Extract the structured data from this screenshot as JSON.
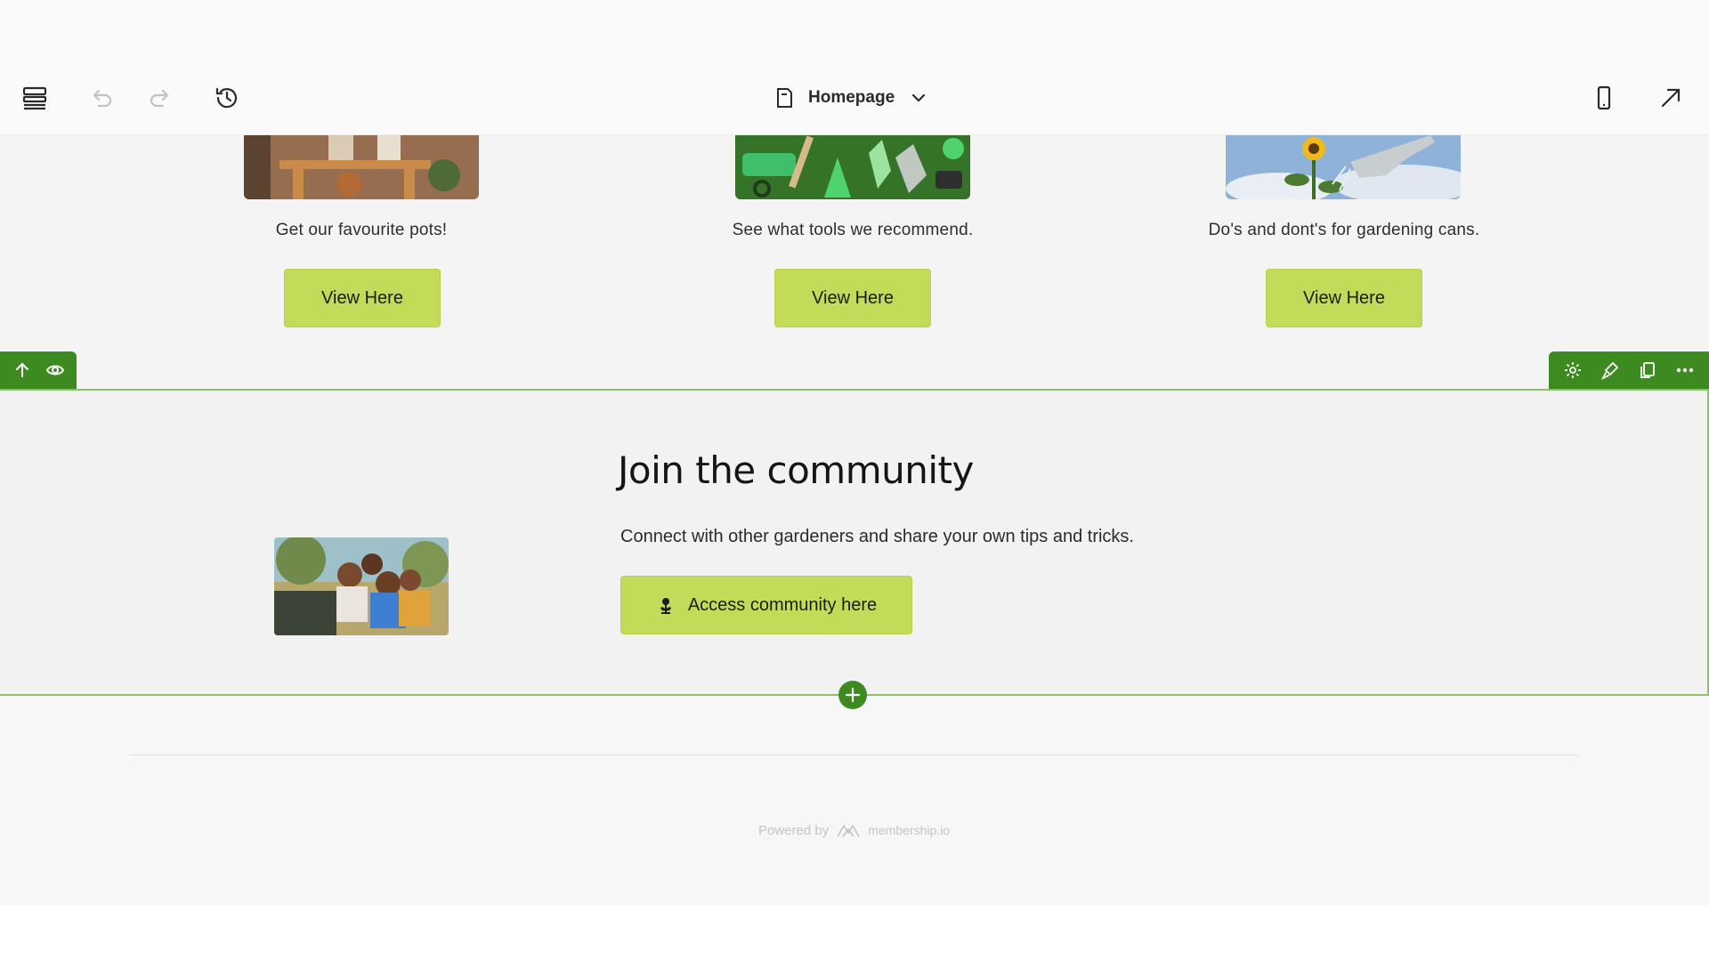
{
  "toolbar": {
    "page_name": "Homepage"
  },
  "cards": [
    {
      "caption": "Get our favourite pots!",
      "button": "View Here"
    },
    {
      "caption": "See what tools we recommend.",
      "button": "View Here"
    },
    {
      "caption": "Do's and dont's for gardening cans.",
      "button": "View Here"
    }
  ],
  "community": {
    "title": "Join the community",
    "subtitle": "Connect with other gardeners and share your own tips and tricks.",
    "button": "Access community here"
  },
  "footer": {
    "powered_by": "Powered by",
    "brand": "membership.io"
  },
  "colors": {
    "accent_green": "#3d8b20",
    "button_lime": "#c2dc5a"
  }
}
